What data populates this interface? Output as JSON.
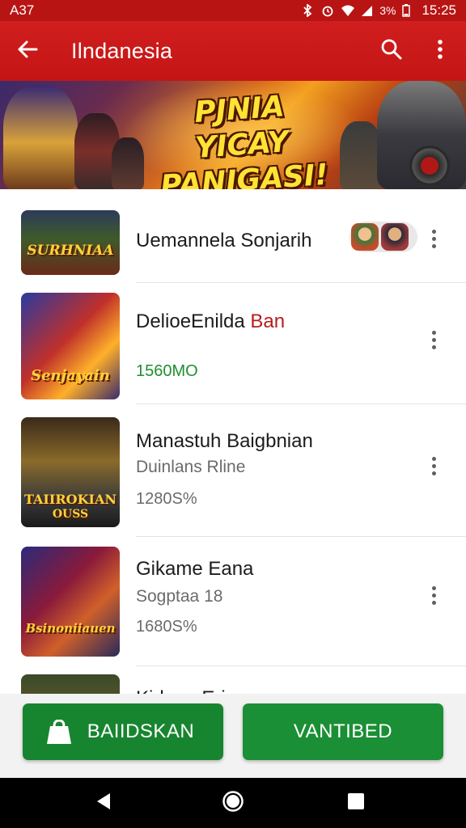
{
  "status_bar": {
    "left_text": "A37",
    "battery_text": "3%",
    "time": "15:25",
    "icons": [
      "bluetooth-icon",
      "alarm-icon",
      "wifi-icon",
      "signal-icon",
      "battery-icon"
    ]
  },
  "app_bar": {
    "title": "Ilndanesia",
    "color": "#c81818",
    "icons": [
      "back-arrow-icon",
      "search-icon",
      "more-vert-icon"
    ]
  },
  "banner": {
    "title_line1": "PJNIA YICAY",
    "title_line2": "PANIGASI!"
  },
  "items": [
    {
      "thumb_text": "SURHNIAA",
      "title": "Uemannela Sonjarih",
      "title_accent": "",
      "subtitle": "",
      "meta": "",
      "meta_color": "gray",
      "has_chips": true
    },
    {
      "thumb_text": "Senjayain",
      "title": "DelioeEnilda ",
      "title_accent": "Ban",
      "subtitle": "",
      "meta": "1560MO",
      "meta_color": "green",
      "has_chips": false
    },
    {
      "thumb_text": "TAIIROKIAN",
      "thumb_subtext": "OUSS",
      "title": "Manastuh Baigbnian",
      "title_accent": "",
      "subtitle": "Duinlans Rline",
      "meta": "1280S%",
      "meta_color": "gray",
      "has_chips": false
    },
    {
      "thumb_text": "Bsinoniiauen",
      "title": "Gikame Eana",
      "title_accent": "",
      "subtitle": "Sogptaa 18",
      "meta": "1680S%",
      "meta_color": "gray",
      "has_chips": false
    },
    {
      "thumb_text": "",
      "title": "Kidene Eri",
      "title_accent": "",
      "subtitle": "",
      "meta": "",
      "meta_color": "gray",
      "has_chips": false
    }
  ],
  "buttons": {
    "left_label": "BAIIDSKAN",
    "right_label": "VANTIBED",
    "left_icon": "android-bag-icon",
    "color": "#1a8f35"
  },
  "nav_bar": {
    "icons": [
      "nav-back-icon",
      "nav-home-icon",
      "nav-recents-icon"
    ]
  }
}
